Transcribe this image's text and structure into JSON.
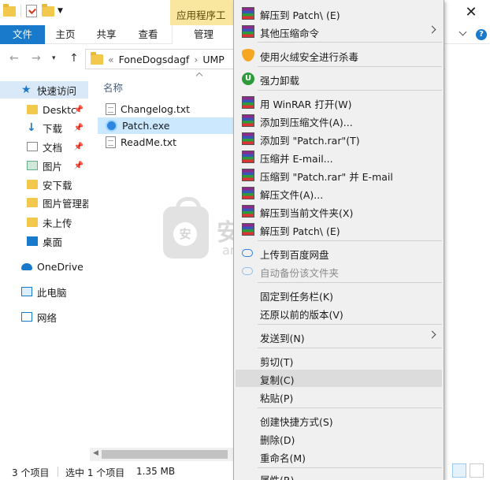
{
  "titlebar": {
    "contextual_tab": "应用程序工具",
    "close_glyph": "✕"
  },
  "ribbon": {
    "tabs": [
      "文件",
      "主页",
      "共享",
      "查看",
      "管理"
    ]
  },
  "address": {
    "prefix": "«",
    "crumbs": [
      "FoneDogsdagf",
      "UMP"
    ],
    "sep": "›"
  },
  "nav_pane": {
    "items": [
      {
        "label": "快速访问",
        "icon": "star-icon"
      },
      {
        "label": "Desktc",
        "icon": "folder-icon",
        "pinned": true
      },
      {
        "label": "下载",
        "icon": "download-icon",
        "pinned": true
      },
      {
        "label": "文档",
        "icon": "document-icon",
        "pinned": true
      },
      {
        "label": "图片",
        "icon": "picture-icon",
        "pinned": true
      },
      {
        "label": "安下载",
        "icon": "folder-icon"
      },
      {
        "label": "图片管理器",
        "icon": "folder-icon"
      },
      {
        "label": "未上传",
        "icon": "folder-icon"
      },
      {
        "label": "桌面",
        "icon": "desktop-icon"
      },
      {
        "label": "OneDrive",
        "icon": "cloud-icon"
      },
      {
        "label": "此电脑",
        "icon": "computer-icon"
      },
      {
        "label": "网络",
        "icon": "network-icon"
      }
    ]
  },
  "content": {
    "column_header": "名称",
    "files": [
      {
        "name": "Changelog.txt",
        "type": "text"
      },
      {
        "name": "Patch.exe",
        "type": "exe",
        "selected": true
      },
      {
        "name": "ReadMe.txt",
        "type": "text"
      }
    ]
  },
  "watermark": {
    "badge": "安",
    "text": "安下载",
    "sub": "anxz.com"
  },
  "status": {
    "count": "3 个项目",
    "selected": "选中 1 个项目",
    "size": "1.35 MB"
  },
  "context_menu": {
    "items": [
      {
        "label": "解压到 Patch\\ (E)",
        "icon": "winrar-icon"
      },
      {
        "label": "其他压缩命令",
        "icon": "winrar-icon",
        "submenu": true
      },
      {
        "label": "使用火绒安全进行杀毒",
        "icon": "huorong-shield-icon"
      },
      {
        "label": "强力卸载",
        "icon": "uninstall-icon"
      },
      {
        "label": "用 WinRAR 打开(W)",
        "icon": "winrar-icon"
      },
      {
        "label": "添加到压缩文件(A)...",
        "icon": "winrar-icon"
      },
      {
        "label": "添加到 \"Patch.rar\"(T)",
        "icon": "winrar-icon"
      },
      {
        "label": "压缩并 E-mail...",
        "icon": "winrar-icon"
      },
      {
        "label": "压缩到 \"Patch.rar\" 并 E-mail",
        "icon": "winrar-icon"
      },
      {
        "label": "解压文件(A)...",
        "icon": "winrar-icon"
      },
      {
        "label": "解压到当前文件夹(X)",
        "icon": "winrar-icon"
      },
      {
        "label": "解压到 Patch\\ (E)",
        "icon": "winrar-icon"
      },
      {
        "label": "上传到百度网盘",
        "icon": "baidu-cloud-icon"
      },
      {
        "label": "自动备份该文件夹",
        "icon": "baidu-backup-icon",
        "disabled": true
      },
      {
        "label": "固定到任务栏(K)",
        "icon": ""
      },
      {
        "label": "还原以前的版本(V)",
        "icon": ""
      },
      {
        "label": "发送到(N)",
        "icon": "",
        "submenu": true
      },
      {
        "label": "剪切(T)",
        "icon": ""
      },
      {
        "label": "复制(C)",
        "icon": "",
        "highlighted": true
      },
      {
        "label": "粘贴(P)",
        "icon": ""
      },
      {
        "label": "创建快捷方式(S)",
        "icon": ""
      },
      {
        "label": "删除(D)",
        "icon": ""
      },
      {
        "label": "重命名(M)",
        "icon": ""
      },
      {
        "label": "属性(R)",
        "icon": ""
      }
    ]
  }
}
